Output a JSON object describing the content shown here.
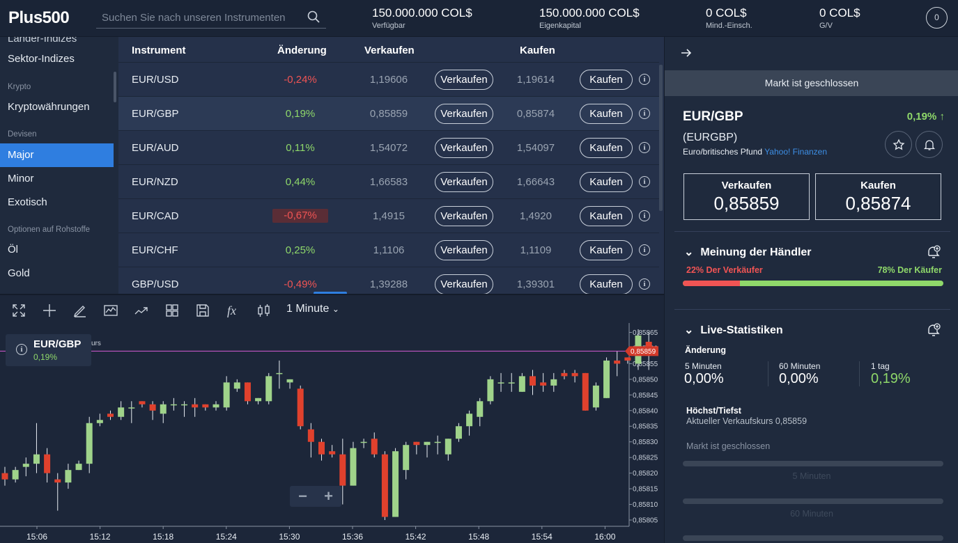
{
  "header": {
    "logo": "Plus500",
    "search_placeholder": "Suchen Sie nach unseren Instrumenten",
    "stats": [
      {
        "value": "150.000.000 COL$",
        "label": "Verfügbar"
      },
      {
        "value": "150.000.000 COL$",
        "label": "Eigenkapital"
      },
      {
        "value": "0 COL$",
        "label": "Mind.-Einsch."
      },
      {
        "value": "0 COL$",
        "label": "G/V"
      }
    ],
    "notification_count": "0"
  },
  "sidebar": {
    "partial_top": "Länder-Indizes",
    "items": {
      "sektor": "Sektor-Indizes",
      "krypto_cat": "Krypto",
      "kryptowaehrungen": "Kryptowährungen",
      "devisen_cat": "Devisen",
      "major": "Major",
      "minor": "Minor",
      "exotisch": "Exotisch",
      "rohstoffe_cat": "Optionen auf Rohstoffe",
      "oel": "Öl",
      "gold": "Gold"
    }
  },
  "table": {
    "headers": {
      "instrument": "Instrument",
      "change": "Änderung",
      "sell": "Verkaufen",
      "buy": "Kaufen"
    },
    "sell_button": "Verkaufen",
    "buy_button": "Kaufen",
    "rows": [
      {
        "instrument": "EUR/USD",
        "change": "-0,24%",
        "sell": "1,19606",
        "buy": "1,19614"
      },
      {
        "instrument": "EUR/GBP",
        "change": "0,19%",
        "sell": "0,85859",
        "buy": "0,85874"
      },
      {
        "instrument": "EUR/AUD",
        "change": "0,11%",
        "sell": "1,54072",
        "buy": "1,54097"
      },
      {
        "instrument": "EUR/NZD",
        "change": "0,44%",
        "sell": "1,66583",
        "buy": "1,66643"
      },
      {
        "instrument": "EUR/CAD",
        "change": "-0,67%",
        "sell": "1,4915",
        "buy": "1,4920"
      },
      {
        "instrument": "EUR/CHF",
        "change": "0,25%",
        "sell": "1,1106",
        "buy": "1,1109"
      },
      {
        "instrument": "GBP/USD",
        "change": "-0,49%",
        "sell": "1,39288",
        "buy": "1,39301"
      }
    ]
  },
  "chart": {
    "timeframe": "1 Minute",
    "legend_symbol": "EUR/GBP",
    "legend_change": "0,19%",
    "legend_hidden_text": "urs",
    "current_price_label": "0,85859",
    "y_ticks": [
      "0,85865",
      "0,85860",
      "0,85855",
      "0,85850",
      "0,85845",
      "0,85840",
      "0,85835",
      "0,85830",
      "0,85825",
      "0,85820",
      "0,85815",
      "0,85810",
      "0,85805"
    ],
    "x_ticks": [
      "15:06",
      "15:12",
      "15:18",
      "15:24",
      "15:30",
      "15:36",
      "15:42",
      "15:48",
      "15:54",
      "16:00"
    ],
    "zoom_out": "−",
    "zoom_in": "+"
  },
  "chart_data": {
    "type": "candlestick",
    "ylim": [
      0.85803,
      0.85868
    ],
    "x_start": "15:06",
    "current_price": 0.85859,
    "candles": [
      [
        0.8582,
        0.85818,
        0.85822,
        0.85816
      ],
      [
        0.85818,
        0.85821,
        0.85822,
        0.85817
      ],
      [
        0.85822,
        0.85823,
        0.85825,
        0.85819
      ],
      [
        0.85823,
        0.85826,
        0.85836,
        0.8582
      ],
      [
        0.85826,
        0.8582,
        0.85828,
        0.85817
      ],
      [
        0.85818,
        0.85817,
        0.8582,
        0.85808
      ],
      [
        0.85817,
        0.85821,
        0.85823,
        0.85815
      ],
      [
        0.85821,
        0.85823,
        0.85824,
        0.85821
      ],
      [
        0.85823,
        0.85836,
        0.85838,
        0.8582
      ],
      [
        0.85836,
        0.85837,
        0.85839,
        0.85835
      ],
      [
        0.85839,
        0.85838,
        0.8584,
        0.85837
      ],
      [
        0.85838,
        0.85841,
        0.85843,
        0.85837
      ],
      [
        0.85841,
        0.85841,
        0.85843,
        0.85836
      ],
      [
        0.85843,
        0.85842,
        0.85843,
        0.85841
      ],
      [
        0.85842,
        0.8584,
        0.85843,
        0.85837
      ],
      [
        0.85839,
        0.85842,
        0.85843,
        0.85836
      ],
      [
        0.85842,
        0.85842,
        0.85844,
        0.8584
      ],
      [
        0.85842,
        0.85842,
        0.85843,
        0.85838
      ],
      [
        0.85842,
        0.85841,
        0.85844,
        0.85838
      ],
      [
        0.85842,
        0.85841,
        0.85842,
        0.8584
      ],
      [
        0.85841,
        0.85842,
        0.85843,
        0.8584
      ],
      [
        0.85841,
        0.85849,
        0.85851,
        0.8584
      ],
      [
        0.85847,
        0.85849,
        0.8585,
        0.85846
      ],
      [
        0.85849,
        0.85843,
        0.85849,
        0.85842
      ],
      [
        0.85843,
        0.85844,
        0.85844,
        0.85842
      ],
      [
        0.85843,
        0.85851,
        0.85852,
        0.85842
      ],
      [
        0.85852,
        0.85852,
        0.85856,
        0.85847
      ],
      [
        0.85849,
        0.8585,
        0.8585,
        0.85847
      ],
      [
        0.85847,
        0.85835,
        0.85848,
        0.85834
      ],
      [
        0.85834,
        0.8583,
        0.85836,
        0.85825
      ],
      [
        0.8583,
        0.85826,
        0.85831,
        0.85824
      ],
      [
        0.85827,
        0.85826,
        0.85829,
        0.85825
      ],
      [
        0.85826,
        0.85816,
        0.85831,
        0.8581
      ],
      [
        0.85816,
        0.85828,
        0.8583,
        0.85816
      ],
      [
        0.8583,
        0.8583,
        0.85831,
        0.85828
      ],
      [
        0.85831,
        0.85826,
        0.85833,
        0.85825
      ],
      [
        0.85826,
        0.85806,
        0.85827,
        0.85805
      ],
      [
        0.85806,
        0.85827,
        0.85828,
        0.85806
      ],
      [
        0.85821,
        0.85829,
        0.8583,
        0.85818
      ],
      [
        0.8583,
        0.85829,
        0.8583,
        0.85826
      ],
      [
        0.85829,
        0.8583,
        0.8583,
        0.85825
      ],
      [
        0.8583,
        0.8583,
        0.85832,
        0.85826
      ],
      [
        0.85826,
        0.85831,
        0.85831,
        0.85824
      ],
      [
        0.85831,
        0.85835,
        0.85836,
        0.8583
      ],
      [
        0.85835,
        0.85839,
        0.8584,
        0.85832
      ],
      [
        0.85838,
        0.85843,
        0.85844,
        0.85835
      ],
      [
        0.85843,
        0.8585,
        0.85851,
        0.85842
      ],
      [
        0.85849,
        0.85849,
        0.85852,
        0.85846
      ],
      [
        0.85849,
        0.85849,
        0.85852,
        0.85846
      ],
      [
        0.85846,
        0.85851,
        0.85852,
        0.85846
      ],
      [
        0.85851,
        0.85848,
        0.85853,
        0.85845
      ],
      [
        0.85849,
        0.85848,
        0.85852,
        0.85846
      ],
      [
        0.85848,
        0.8585,
        0.85852,
        0.85846
      ],
      [
        0.85852,
        0.85851,
        0.85853,
        0.8585
      ],
      [
        0.85852,
        0.85851,
        0.85853,
        0.85849
      ],
      [
        0.85852,
        0.8584,
        0.85852,
        0.8584
      ],
      [
        0.85841,
        0.85848,
        0.85849,
        0.8584
      ],
      [
        0.85844,
        0.85856,
        0.85857,
        0.85844
      ],
      [
        0.85856,
        0.85855,
        0.85859,
        0.85851
      ],
      [
        0.85857,
        0.85856,
        0.85857,
        0.85855
      ],
      [
        0.85855,
        0.85864,
        0.85866,
        0.85853
      ],
      [
        0.85862,
        0.85859,
        0.85865,
        0.85853
      ]
    ]
  },
  "panel": {
    "market_status": "Markt ist geschlossen",
    "symbol": "EUR/GBP",
    "change": "0,19%",
    "code": "(EURGBP)",
    "description": "Euro/britisches Pfund",
    "source_link": "Yahoo! Finanzen",
    "sell_label": "Verkaufen",
    "sell_value": "0,85859",
    "buy_label": "Kaufen",
    "buy_value": "0,85874",
    "sentiment": {
      "title": "Meinung der Händler",
      "sellers_text": "22% Der Verkäufer",
      "buyers_text": "78% Der Käufer",
      "sellers_pct": 22
    },
    "live": {
      "title": "Live-Statistiken",
      "change_label": "Änderung",
      "m5_label": "5 Minuten",
      "m5_value": "0,00%",
      "m60_label": "60 Minuten",
      "m60_value": "0,00%",
      "d1_label": "1 tag",
      "d1_value": "0,19%",
      "highlow_label": "Höchst/Tiefst",
      "current_sell": "Aktueller Verkaufskurs 0,85859",
      "closed_note": "Markt ist geschlossen",
      "range1_label": "5 Minuten",
      "range2_label": "60 Minuten"
    }
  }
}
